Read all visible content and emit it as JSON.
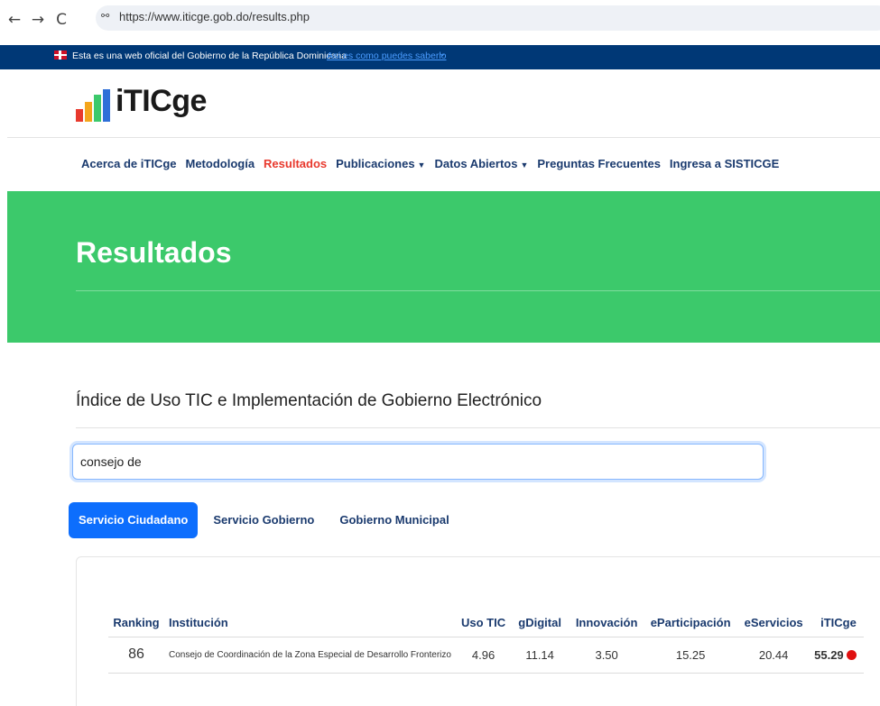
{
  "browser": {
    "url": "https://www.iticge.gob.do/results.php",
    "back_icon": "←",
    "forward_icon": "→",
    "reload_icon": "C",
    "site_info_icon": "⚯"
  },
  "gov_banner": {
    "text": "Esta es una web oficial del Gobierno de la República Dominicana",
    "link": "Así es como puedes saberlo"
  },
  "logo": {
    "text": "iTICge",
    "bar_colors": [
      "#e8392d",
      "#f4a51c",
      "#3cc96b",
      "#2f6fd8"
    ]
  },
  "nav": {
    "items": [
      {
        "label": "Acerca de iTICge",
        "active": false
      },
      {
        "label": "Metodología",
        "active": false
      },
      {
        "label": "Resultados",
        "active": true
      },
      {
        "label": "Publicaciones",
        "active": false,
        "dropdown": true
      },
      {
        "label": "Datos Abiertos",
        "active": false,
        "dropdown": true
      },
      {
        "label": "Preguntas Frecuentes",
        "active": false
      },
      {
        "label": "Ingresa a SISTICGE",
        "active": false
      }
    ]
  },
  "hero": {
    "title": "Resultados",
    "color": "#3cc96b"
  },
  "section": {
    "title": "Índice de Uso TIC e Implementación de Gobierno Electrónico"
  },
  "search": {
    "value": "consejo de"
  },
  "tabs": [
    {
      "label": "Servicio Ciudadano",
      "active": true
    },
    {
      "label": "Servicio Gobierno",
      "active": false
    },
    {
      "label": "Gobierno Municipal",
      "active": false
    }
  ],
  "table": {
    "headers": {
      "ranking": "Ranking",
      "institucion": "Institución",
      "uso_tic": "Uso TIC",
      "gdigital": "gDigital",
      "innovacion": "Innovación",
      "eparticipacion": "eParticipación",
      "eservicios": "eServicios",
      "iticge": "iTICge"
    },
    "rows": [
      {
        "ranking": "86",
        "institucion": "Consejo de Coordinación de la Zona Especial de Desarrollo Fronterizo",
        "uso_tic": "4.96",
        "gdigital": "11.14",
        "innovacion": "3.50",
        "eparticipacion": "15.25",
        "eservicios": "20.44",
        "iticge": "55.29",
        "status_color": "#e01010"
      }
    ]
  },
  "colors": {
    "banner": "#003876",
    "accent_active": "#e8392d",
    "tab_active": "#0d6efd",
    "nav_text": "#1a3a6e"
  }
}
